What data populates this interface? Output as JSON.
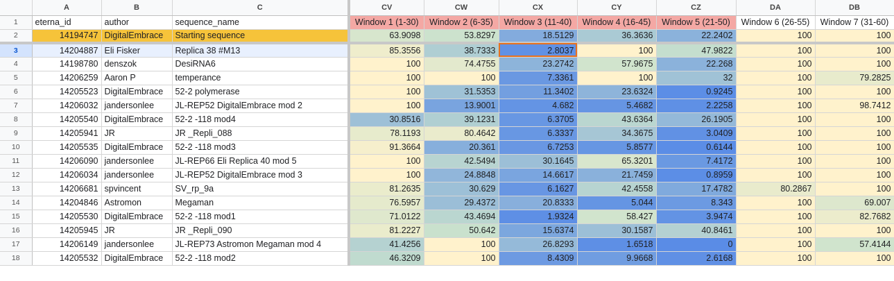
{
  "colors": {
    "header_bg": "#f8f9fa",
    "yellow": "#fff2cc",
    "orange_row": "#f6c33a",
    "pink_header": "#f4a8a4",
    "active_outline": "#e8711e",
    "selected_row": "#e8f0fe"
  },
  "columns": [
    "A",
    "B",
    "C",
    "CV",
    "CW",
    "CX",
    "CY",
    "CZ",
    "DA",
    "DB"
  ],
  "header_row": [
    "eterna_id",
    "author",
    "sequence_name",
    "Window 1 (1-30)",
    "Window 2 (6-35)",
    "Window 3 (11-40)",
    "Window 4 (16-45)",
    "Window 5 (21-50)",
    "Window 6 (26-55)",
    "Window 7 (31-60)"
  ],
  "rows": [
    {
      "n": "2",
      "cells": [
        "14194747",
        "DigitalEmbrace",
        "Starting sequence",
        "63.9098",
        "53.8297",
        "18.5129",
        "36.3636",
        "22.2402",
        "100",
        "100"
      ]
    },
    {
      "n": "3",
      "cells": [
        "14204887",
        "Eli Fisker",
        "Replica 38 #M13",
        "85.3556",
        "38.7333",
        "2.8037",
        "100",
        "47.9822",
        "100",
        "100"
      ]
    },
    {
      "n": "4",
      "cells": [
        "14198780",
        "denszok",
        "DesiRNA6",
        "100",
        "74.4755",
        "23.2742",
        "57.9675",
        "22.268",
        "100",
        "100"
      ]
    },
    {
      "n": "5",
      "cells": [
        "14206259",
        "Aaron P",
        "temperance",
        "100",
        "100",
        "7.3361",
        "100",
        "32",
        "100",
        "79.2825"
      ]
    },
    {
      "n": "6",
      "cells": [
        "14205523",
        "DigitalEmbrace",
        "52-2 polymerase",
        "100",
        "31.5353",
        "11.3402",
        "23.6324",
        "0.9245",
        "100",
        "100"
      ]
    },
    {
      "n": "7",
      "cells": [
        "14206032",
        "jandersonlee",
        "JL-REP52 DigitalEmbrace mod 2",
        "100",
        "13.9001",
        "4.682",
        "5.4682",
        "2.2258",
        "100",
        "98.7412"
      ]
    },
    {
      "n": "8",
      "cells": [
        "14205540",
        "DigitalEmbrace",
        "52-2 -118 mod4",
        "30.8516",
        "39.1231",
        "6.3705",
        "43.6364",
        "26.1905",
        "100",
        "100"
      ]
    },
    {
      "n": "9",
      "cells": [
        "14205941",
        "JR",
        "JR _Repli_088",
        "78.1193",
        "80.4642",
        "6.3337",
        "34.3675",
        "3.0409",
        "100",
        "100"
      ]
    },
    {
      "n": "10",
      "cells": [
        "14205535",
        "DigitalEmbrace",
        "52-2 -118 mod3",
        "91.3664",
        "20.361",
        "6.7253",
        "5.8577",
        "0.6144",
        "100",
        "100"
      ]
    },
    {
      "n": "11",
      "cells": [
        "14206090",
        "jandersonlee",
        "JL-REP66 Eli Replica 40 mod 5",
        "100",
        "42.5494",
        "30.1645",
        "65.3201",
        "7.4172",
        "100",
        "100"
      ]
    },
    {
      "n": "12",
      "cells": [
        "14206034",
        "jandersonlee",
        "JL-REP52 DigitalEmbrace mod 3",
        "100",
        "24.8848",
        "14.6617",
        "21.7459",
        "0.8959",
        "100",
        "100"
      ]
    },
    {
      "n": "13",
      "cells": [
        "14206681",
        "spvincent",
        "SV_rp_9a",
        "81.2635",
        "30.629",
        "6.1627",
        "42.4558",
        "17.4782",
        "80.2867",
        "100"
      ]
    },
    {
      "n": "14",
      "cells": [
        "14204846",
        "Astromon",
        "Megaman",
        "76.5957",
        "29.4372",
        "20.8333",
        "5.044",
        "8.343",
        "100",
        "69.007"
      ]
    },
    {
      "n": "15",
      "cells": [
        "14205530",
        "DigitalEmbrace",
        "52-2 -118 mod1",
        "71.0122",
        "43.4694",
        "1.9324",
        "58.427",
        "3.9474",
        "100",
        "82.7682"
      ]
    },
    {
      "n": "16",
      "cells": [
        "14205945",
        "JR",
        "JR _Repli_090",
        "81.2227",
        "50.642",
        "15.6374",
        "30.1587",
        "40.8461",
        "100",
        "100"
      ]
    },
    {
      "n": "17",
      "cells": [
        "14206149",
        "jandersonlee",
        "JL-REP73 Astromon Megaman mod 4",
        "41.4256",
        "100",
        "26.8293",
        "1.6518",
        "0",
        "100",
        "57.4144"
      ]
    },
    {
      "n": "18",
      "cells": [
        "14205532",
        "DigitalEmbrace",
        "52-2 -118 mod2",
        "46.3209",
        "100",
        "8.4309",
        "9.9668",
        "2.6168",
        "100",
        "100"
      ]
    }
  ]
}
